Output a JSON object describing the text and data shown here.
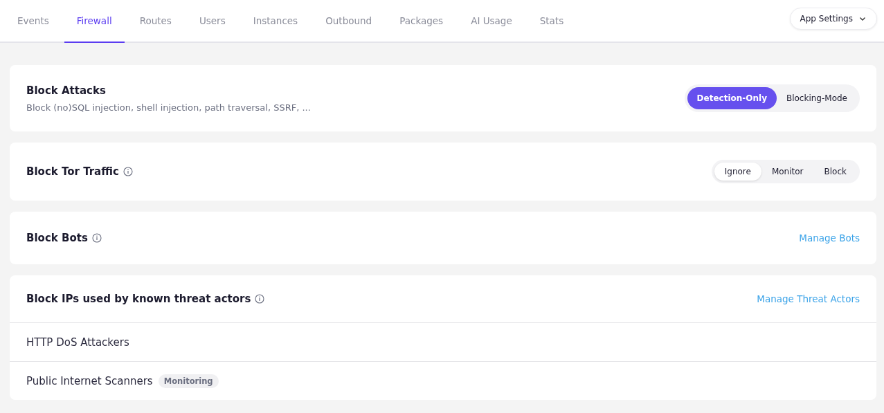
{
  "tabs": [
    {
      "label": "Events",
      "selected": false
    },
    {
      "label": "Firewall",
      "selected": true
    },
    {
      "label": "Routes",
      "selected": false
    },
    {
      "label": "Users",
      "selected": false
    },
    {
      "label": "Instances",
      "selected": false
    },
    {
      "label": "Outbound",
      "selected": false
    },
    {
      "label": "Packages",
      "selected": false
    },
    {
      "label": "AI Usage",
      "selected": false
    },
    {
      "label": "Stats",
      "selected": false
    }
  ],
  "settings_button": {
    "label": "App Settings"
  },
  "cards": [
    {
      "kind": "mode-switch",
      "title": "Block Attacks",
      "info": false,
      "description": "Block (no)SQL injection, shell injection, path traversal, SSRF, ...",
      "options": [
        {
          "label": "Detection-Only",
          "selected": true
        },
        {
          "label": "Blocking-Mode",
          "selected": false
        }
      ]
    },
    {
      "kind": "segmented",
      "title": "Block Tor Traffic",
      "info": true,
      "options": [
        {
          "label": "Ignore",
          "selected": true
        },
        {
          "label": "Monitor",
          "selected": false
        },
        {
          "label": "Block",
          "selected": false
        }
      ]
    },
    {
      "kind": "link",
      "title": "Block Bots",
      "info": true,
      "link": "Manage Bots"
    },
    {
      "kind": "list",
      "title": "Block IPs used by known threat actors",
      "info": true,
      "link": "Manage Threat Actors",
      "items": [
        {
          "label": "HTTP DoS Attackers"
        },
        {
          "label": "Public Internet Scanners",
          "badge": "Monitoring"
        }
      ]
    }
  ]
}
